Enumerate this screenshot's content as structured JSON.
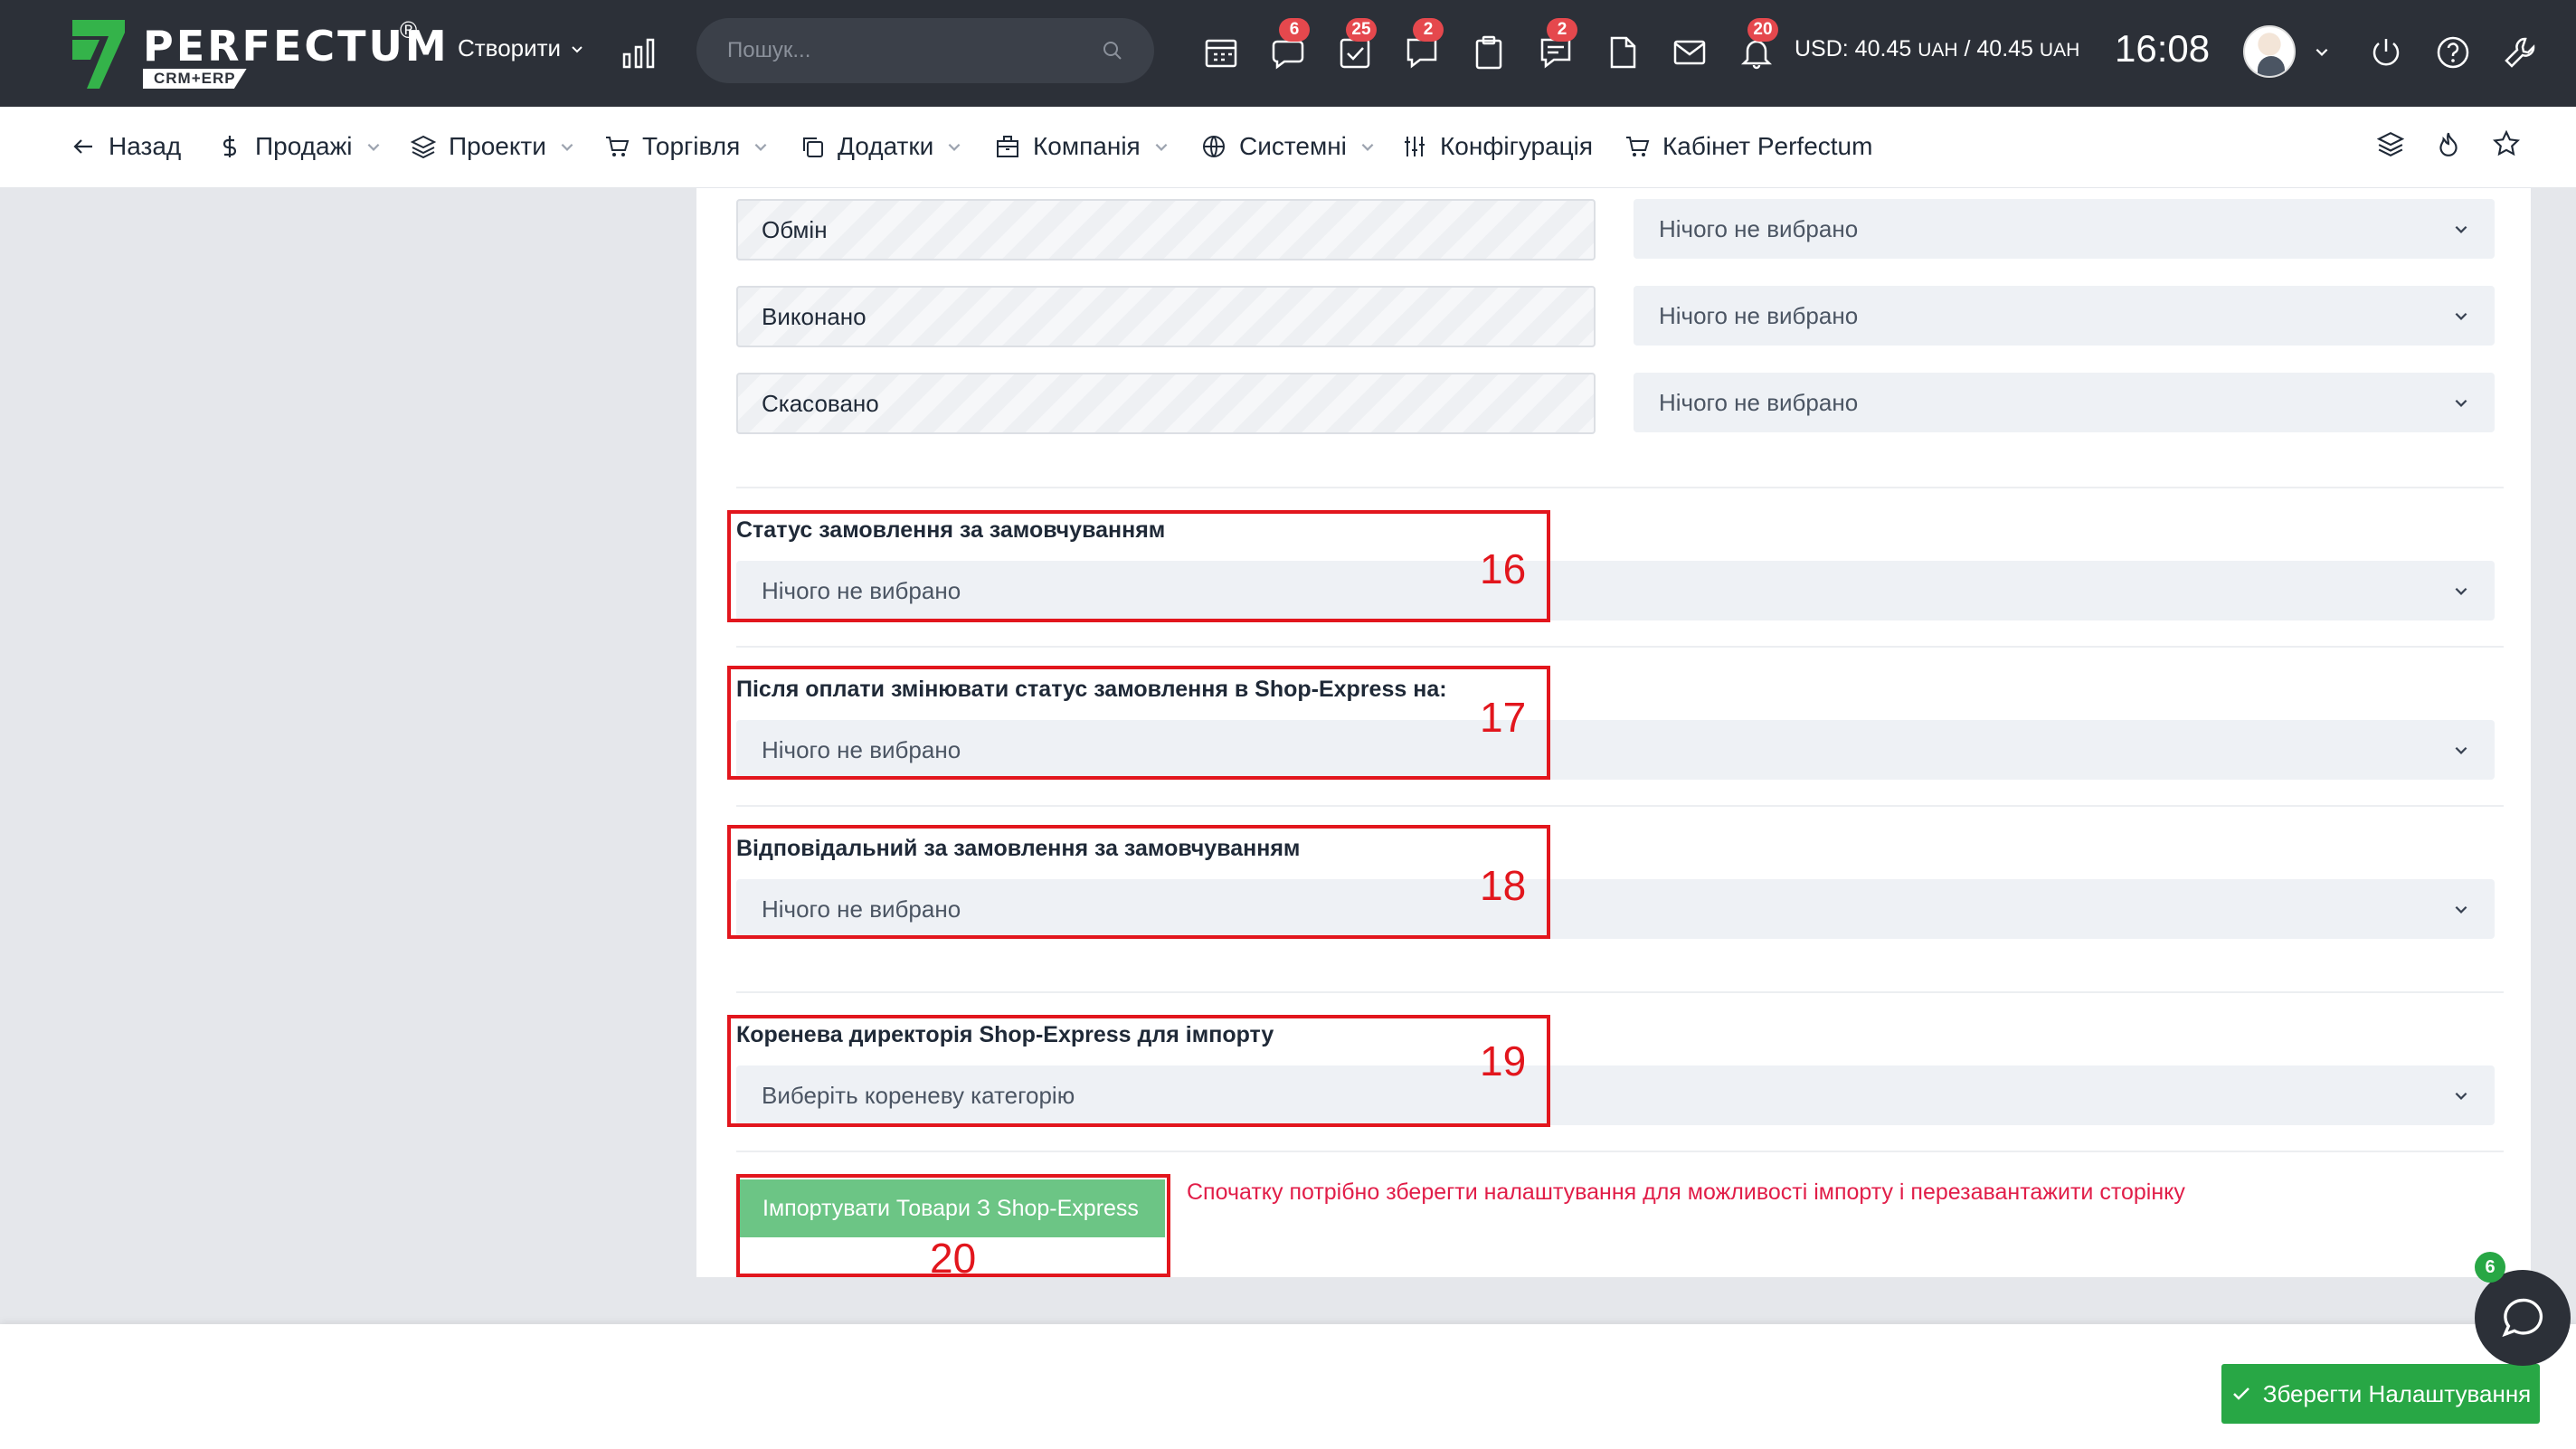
{
  "topbar": {
    "brand": "PERFECTUM",
    "brand_sub": "CRM+ERP",
    "registered": "®",
    "create_label": "Створити",
    "search_placeholder": "Пошук...",
    "badges": {
      "messages": "6",
      "tasks": "25",
      "chat": "2",
      "notes": "2",
      "notifications": "20"
    },
    "rate_label": "USD: 40.45",
    "rate_unit_1": "UAH",
    "rate_sep": "/ 40.45",
    "rate_unit_2": "UAH",
    "clock": "16:08"
  },
  "nav": {
    "back": "Назад",
    "sales": "Продажі",
    "projects": "Проекти",
    "trade": "Торгівля",
    "addons": "Додатки",
    "company": "Компанія",
    "system": "Системні",
    "config": "Конфігурація",
    "cabinet": "Кабінет Perfectum"
  },
  "status_rows": [
    {
      "name": "Обмін",
      "select": "Нічого не вибрано"
    },
    {
      "name": "Виконано",
      "select": "Нічого не вибрано"
    },
    {
      "name": "Скасовано",
      "select": "Нічого не вибрано"
    }
  ],
  "fields": {
    "default_status": {
      "label": "Статус замовлення за замовчуванням",
      "value": "Нічого не вибрано",
      "num": "16"
    },
    "after_payment": {
      "label": "Після оплати змінювати статус замовлення в Shop-Express на:",
      "value": "Нічого не вибрано",
      "num": "17"
    },
    "responsible": {
      "label": "Відповідальний за замовлення за замовчуванням",
      "value": "Нічого не вибрано",
      "num": "18"
    },
    "root_dir": {
      "label": "Коренева директорія Shop-Express для імпорту",
      "value": "Виберіть кореневу категорію",
      "num": "19"
    }
  },
  "import": {
    "button": "Імпортувати Товари З Shop-Express",
    "num": "20",
    "warning": "Спочатку потрібно зберегти налаштування для можливості імпорту і перезавантажити сторінку"
  },
  "save_button": "Зберегти Налаштування",
  "chat_badge": "6",
  "colors": {
    "topbar": "#2c3038",
    "accent_green": "#28a745",
    "annotation_red": "#e2161d",
    "badge_red": "#e5484d",
    "warning": "#e11d48"
  }
}
